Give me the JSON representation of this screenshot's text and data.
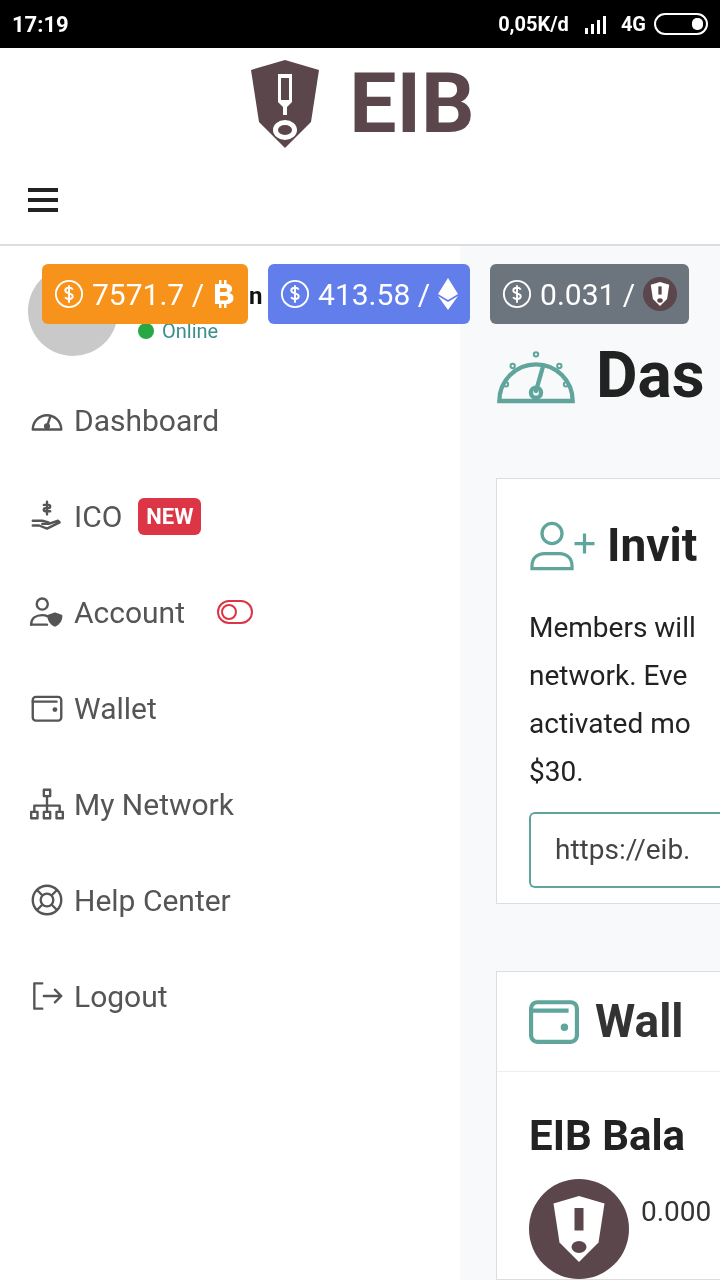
{
  "status_bar": {
    "time": "17:19",
    "speed": "0,05K/d",
    "network": "4G"
  },
  "header": {
    "brand": "EIB"
  },
  "prices": [
    {
      "kind": "btc",
      "value": "7571.7 /",
      "color": "#f7931a"
    },
    {
      "kind": "eth",
      "value": "413.58 /",
      "color": "#627eea"
    },
    {
      "kind": "eib",
      "value": "0.031 /",
      "color": "#6c757d"
    }
  ],
  "profile": {
    "name": "n",
    "status": "Online",
    "online": true
  },
  "sidebar": {
    "items": [
      {
        "kind": "dashboard",
        "label": "Dashboard"
      },
      {
        "kind": "ico",
        "label": "ICO",
        "badge": "NEW"
      },
      {
        "kind": "account",
        "label": "Account",
        "toggle": {
          "on": false
        }
      },
      {
        "kind": "wallet",
        "label": "Wallet"
      },
      {
        "kind": "network",
        "label": "My Network"
      },
      {
        "kind": "help",
        "label": "Help Center"
      },
      {
        "kind": "logout",
        "label": "Logout"
      }
    ]
  },
  "main": {
    "title": "Das",
    "invite_card": {
      "title": "Invit",
      "text_lines": [
        "Members will",
        "network. Eve",
        "activated mo",
        "$30."
      ],
      "link_value": "https://eib."
    },
    "wallet_card": {
      "title": "Wall",
      "balance_title": "EIB Bala",
      "balance": "0.000"
    }
  }
}
